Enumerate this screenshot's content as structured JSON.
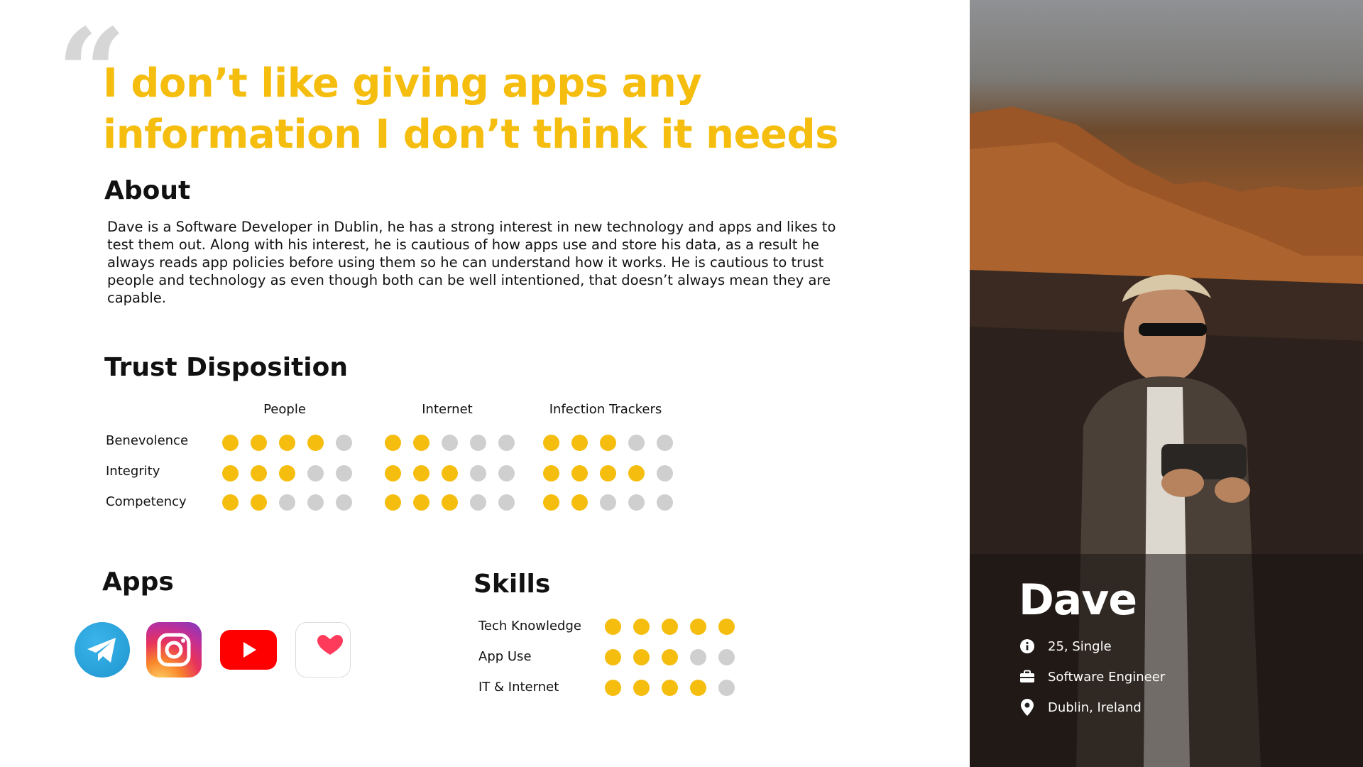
{
  "quote": {
    "mark": "“",
    "text": "I don’t like giving apps any information I don’t think it needs"
  },
  "about": {
    "title": "About",
    "text": "Dave is a Software Developer in Dublin, he has a strong interest in new technology and apps and likes to test them out. Along with his interest, he is cautious of how apps use and store his data, as a result he always reads app policies before using them so he can understand how it works. He is cautious to trust people and technology as even though both can be well intentioned, that doesn’t always mean they are capable."
  },
  "trust": {
    "title": "Trust Disposition",
    "columns": [
      "People",
      "Internet",
      "Infection Trackers"
    ],
    "rows": [
      {
        "label": "Benevolence",
        "ratings": [
          4,
          2,
          3
        ]
      },
      {
        "label": "Integrity",
        "ratings": [
          3,
          3,
          4
        ]
      },
      {
        "label": "Competency",
        "ratings": [
          2,
          3,
          2
        ]
      }
    ],
    "max": 5
  },
  "apps": {
    "title": "Apps",
    "items": [
      "telegram-icon",
      "instagram-icon",
      "youtube-icon",
      "health-icon"
    ]
  },
  "skills": {
    "title": "Skills",
    "items": [
      {
        "label": "Tech Knowledge",
        "rating": 5
      },
      {
        "label": "App Use",
        "rating": 3
      },
      {
        "label": "IT & Internet",
        "rating": 4
      }
    ],
    "max": 5
  },
  "profile": {
    "name": "Dave",
    "age_status": "25, Single",
    "occupation": "Software Engineer",
    "location": "Dublin, Ireland"
  },
  "colors": {
    "accent": "#f5bd0e",
    "dot_off": "#cfcfcf",
    "quote_mark": "#d6d6d6"
  }
}
